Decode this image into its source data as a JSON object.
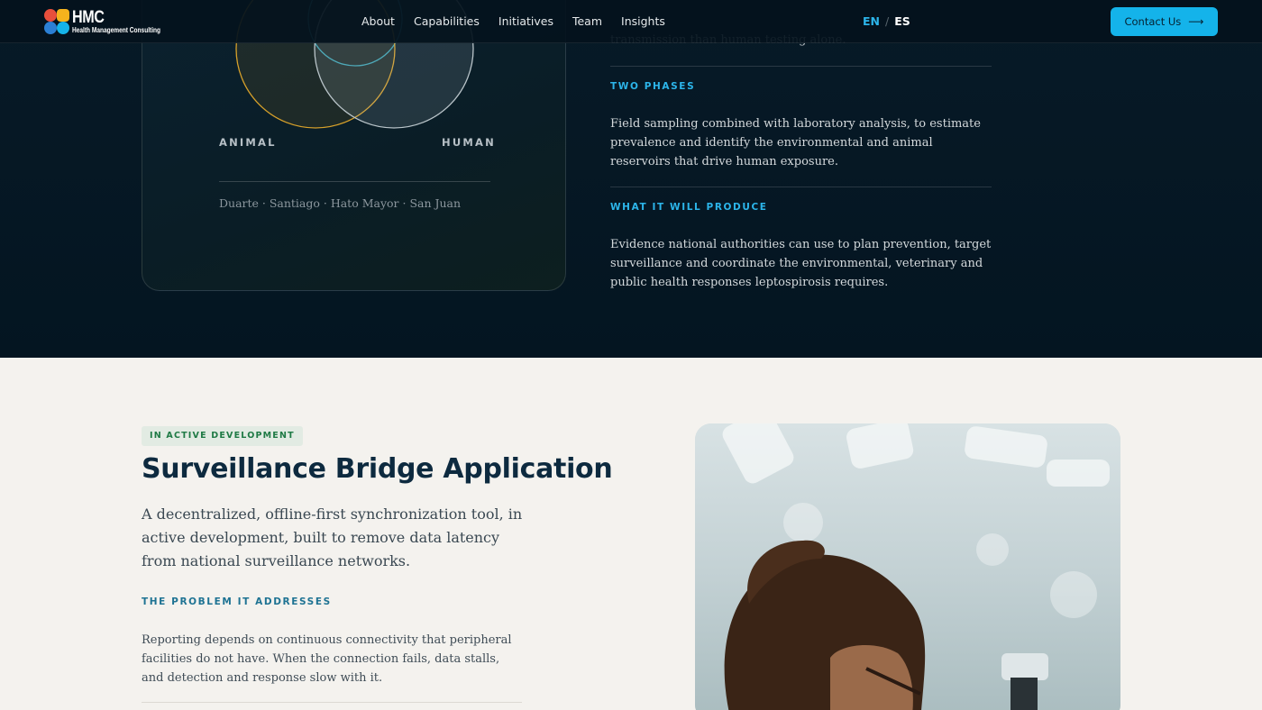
{
  "brand": {
    "logo_text": "HMC",
    "logo_subtext": "Health Management Consulting",
    "logo_colors": [
      "#e84f3c",
      "#f5b31d",
      "#2b7fd4",
      "#15b3e8"
    ]
  },
  "nav": {
    "links": [
      {
        "label": "About"
      },
      {
        "label": "Capabilities"
      },
      {
        "label": "Initiatives"
      },
      {
        "label": "Team"
      },
      {
        "label": "Insights"
      }
    ],
    "lang_en": "EN",
    "lang_sep": "/",
    "lang_es": "ES",
    "contact_label": "Contact Us",
    "contact_icon": "arrow-right-icon"
  },
  "venn": {
    "label_animal": "ANIMAL",
    "label_human": "HUMAN",
    "places": "Duarte · Santiago · Hato Mayor · San Juan"
  },
  "info": {
    "partial_text": "transmission than human testing alone.",
    "sections": [
      {
        "heading": "TWO PHASES",
        "text": "Field sampling combined with laboratory analysis, to estimate prevalence and identify the environmental and animal reservoirs that drive human exposure."
      },
      {
        "heading": "WHAT IT WILL PRODUCE",
        "text": "Evidence national authorities can use to plan prevention, target surveillance and coordinate the environmental, veterinary and public health responses leptospirosis requires."
      }
    ]
  },
  "project": {
    "badge": "IN ACTIVE DEVELOPMENT",
    "title": "Surveillance Bridge Application",
    "lead": "A decentralized, offline-first synchronization tool, in active development, built to remove data latency from national surveillance networks.",
    "problem_heading": "THE PROBLEM IT ADDRESSES",
    "problem_text": "Reporting depends on continuous connectivity that peripheral facilities do not have. When the connection fails, data stalls, and detection and response slow with it."
  },
  "colors": {
    "accent": "#14b3ea",
    "dark_bg": "#041521",
    "light_bg": "#f4f2ee",
    "title": "#0d2a3f",
    "badge_text": "#1f7a45"
  }
}
